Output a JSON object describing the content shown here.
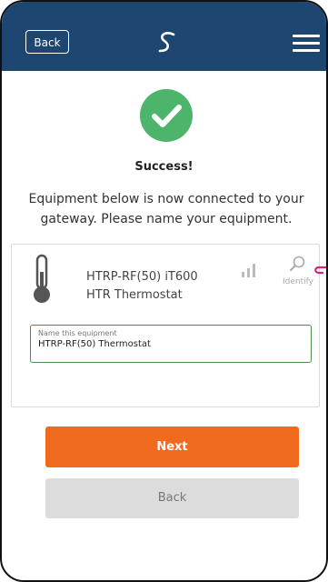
{
  "header": {
    "back_label": "Back",
    "logo_icon": "salus-logo-icon",
    "menu_icon": "hamburger-menu-icon",
    "background": "#1d4670"
  },
  "status": {
    "title": "Success!",
    "message": "Equipment below is now connected to your gateway. Please name your equipment.",
    "icon": "checkmark-circle-icon",
    "color": "#4cb46b"
  },
  "equipment": {
    "icon": "thermometer-icon",
    "model": "HTRP-RF(50) iT600",
    "type": "HTR Thermostat",
    "signal_icon": "signal-strength-icon",
    "identify_label": "Identify",
    "name_field": {
      "label": "Name this equipment",
      "value": "HTRP-RF(50) Thermostat"
    }
  },
  "actions": {
    "next_label": "Next",
    "back_label": "Back",
    "next_color": "#f06b1d"
  }
}
